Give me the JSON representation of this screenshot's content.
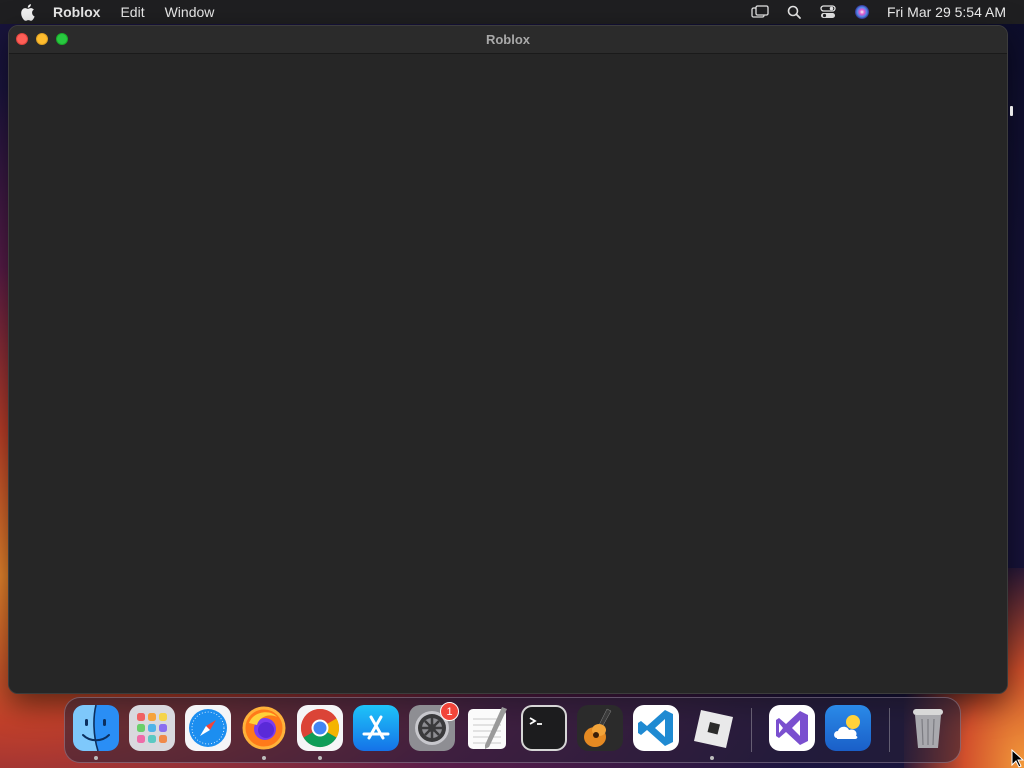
{
  "menubar": {
    "app_name": "Roblox",
    "items": [
      "Edit",
      "Window"
    ],
    "clock": "Fri Mar 29  5:54 AM",
    "status_icons": [
      "screen-mirroring-icon",
      "search-icon",
      "control-center-icon",
      "siri-icon"
    ]
  },
  "window": {
    "title": "Roblox"
  },
  "dock": {
    "apps": [
      {
        "name": "Finder",
        "icon": "finder-icon",
        "running": true
      },
      {
        "name": "Launchpad",
        "icon": "launchpad-icon",
        "running": false
      },
      {
        "name": "Safari",
        "icon": "safari-icon",
        "running": false
      },
      {
        "name": "Firefox",
        "icon": "firefox-icon",
        "running": true
      },
      {
        "name": "Google Chrome",
        "icon": "chrome-icon",
        "running": true
      },
      {
        "name": "App Store",
        "icon": "app-store-icon",
        "running": false
      },
      {
        "name": "System Settings",
        "icon": "system-settings-icon",
        "running": false,
        "badge": "1"
      },
      {
        "name": "TextEdit",
        "icon": "textedit-icon",
        "running": false
      },
      {
        "name": "Terminal",
        "icon": "terminal-icon",
        "running": false
      },
      {
        "name": "GarageBand",
        "icon": "garageband-icon",
        "running": false
      },
      {
        "name": "Visual Studio Code",
        "icon": "vscode-icon",
        "running": false
      },
      {
        "name": "Roblox",
        "icon": "roblox-icon",
        "running": true
      },
      {
        "name": "Visual Studio",
        "icon": "visual-studio-icon",
        "running": false
      },
      {
        "name": "Weather",
        "icon": "weather-icon",
        "running": false
      },
      {
        "name": "Trash",
        "icon": "trash-icon",
        "running": false
      }
    ]
  },
  "colors": {
    "close": "#fe5f57",
    "minimize": "#febc2e",
    "zoom": "#28c840",
    "window_bg": "#262626",
    "badge": "#f2453a"
  }
}
